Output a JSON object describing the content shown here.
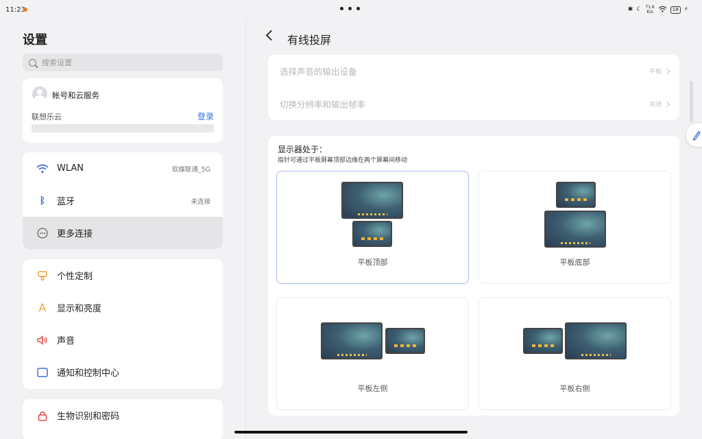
{
  "status": {
    "time": "11:23",
    "net_speed_value": "71.6",
    "net_speed_unit": "K/s",
    "battery": "18"
  },
  "left": {
    "title": "设置",
    "search_placeholder": "搜索设置",
    "account": {
      "title": "帐号和云服务",
      "sub": "联想乐云",
      "login": "登录"
    },
    "connectivity": [
      {
        "label": "WLAN",
        "value": "软媒联通_5G"
      },
      {
        "label": "蓝牙",
        "value": "未连接"
      },
      {
        "label": "更多连接",
        "value": ""
      }
    ],
    "personal": [
      {
        "label": "个性定制"
      },
      {
        "label": "显示和亮度"
      },
      {
        "label": "声音"
      },
      {
        "label": "通知和控制中心"
      }
    ],
    "security": [
      {
        "label": "生物识别和密码"
      }
    ]
  },
  "right": {
    "title": "有线投屏",
    "options": [
      {
        "label": "选择声音的输出设备",
        "value": "平板"
      },
      {
        "label": "切换分辨率和输出帧率",
        "value": "关闭"
      }
    ],
    "display": {
      "title": "显示器处于：",
      "hint": "指针可通过平板屏幕顶部边缘在两个屏幕间移动",
      "positions": [
        {
          "label": "平板顶部",
          "selected": true
        },
        {
          "label": "平板底部",
          "selected": false
        },
        {
          "label": "平板左侧",
          "selected": false
        },
        {
          "label": "平板右侧",
          "selected": false
        }
      ]
    }
  }
}
